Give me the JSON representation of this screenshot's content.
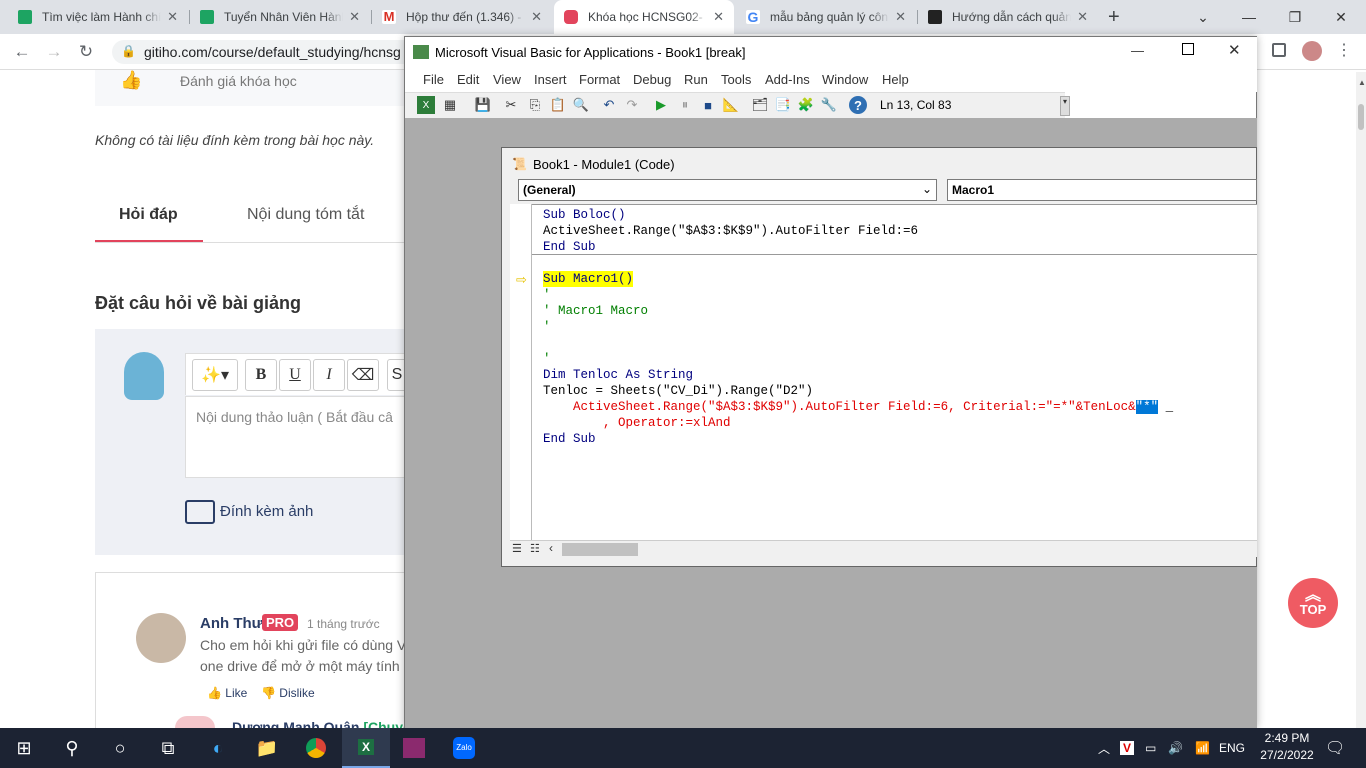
{
  "browser": {
    "tabs": [
      {
        "title": "Tìm việc làm Hành chín",
        "color": "#1da462"
      },
      {
        "title": "Tuyển Nhân Viên Hành",
        "color": "#1da462"
      },
      {
        "title": "Hộp thư đến (1.346) -",
        "color": "#d93025"
      },
      {
        "title": "Khóa học HCNSG02-",
        "color": "#e2445c"
      },
      {
        "title": "mẫu bảng quản lý côn",
        "color": "#4285f4"
      },
      {
        "title": "Hướng dẫn cách quản",
        "color": "#222222"
      }
    ],
    "url": "gitiho.com/course/default_studying/hcnsg"
  },
  "page": {
    "rating_label": "Đánh giá khóa học",
    "no_attachment": "Không có tài liệu đính kèm trong bài học này.",
    "tabs": [
      "Hỏi đáp",
      "Nội dung tóm tắt"
    ],
    "ask_title": "Đặt câu hỏi về bài giảng",
    "editor_placeholder": "Nội dung thảo luận ( Bắt đầu câ",
    "attach_image": "Đính kèm ảnh",
    "comment": {
      "author": "Anh Thư",
      "badge": "PRO",
      "time": "1 tháng trước",
      "line1": "Cho em hỏi khi gửi file có dùng V",
      "line2": "one drive để mở ở một máy tính",
      "like": "Like",
      "dislike": "Dislike",
      "reply_author": "Dương Mạnh Quân",
      "reply_tag": "[Chuyê"
    },
    "top_label": "TOP"
  },
  "vba": {
    "title": "Microsoft Visual Basic for Applications - Book1 [break]",
    "menu": [
      "File",
      "Edit",
      "View",
      "Insert",
      "Format",
      "Debug",
      "Run",
      "Tools",
      "Add-Ins",
      "Window",
      "Help"
    ],
    "status": "Ln 13, Col 83",
    "code_window_title": "Book1 - Module1 (Code)",
    "object_combo": "(General)",
    "proc_combo": "Macro1",
    "code": {
      "l1": "Sub Boloc()",
      "l2": "ActiveSheet.Range(\"$A$3:$K$9\").AutoFilter Field:=6",
      "l3": "End Sub",
      "l4": "Sub Macro1()",
      "l5": "'",
      "l6": "' Macro1 Macro",
      "l7": "'",
      "l8": "'",
      "l9": "Dim Tenloc As String",
      "l10": "Tenloc = Sheets(\"CV_Di\").Range(\"D2\")",
      "l11a": "    ActiveSheet.Range(\"$A$3:$K$9\").AutoFilter Field:=6, Criterial:=\"=*\"&TenLoc&",
      "l11b": "\"*\"",
      "l11c": " _",
      "l12": "        , Operator:=xlAnd",
      "l13": "End Sub"
    }
  },
  "taskbar": {
    "lang": "ENG",
    "time": "2:49 PM",
    "date": "27/2/2022"
  }
}
